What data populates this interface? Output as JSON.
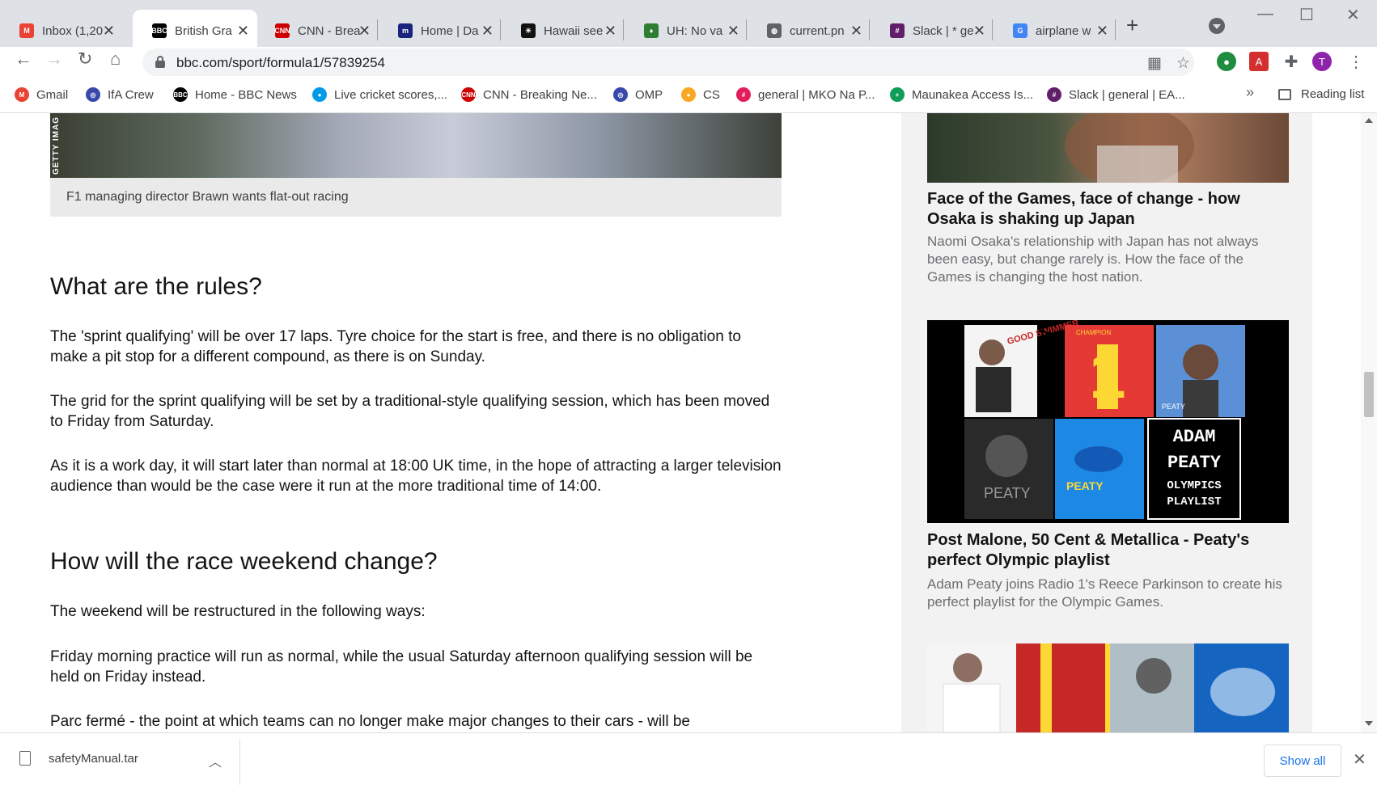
{
  "browser": {
    "tabs": [
      {
        "label": "Inbox (1,20",
        "icon": "gmail-icon",
        "color": "#ea4335",
        "glyph": "M"
      },
      {
        "label": "British Gra",
        "icon": "bbc-icon",
        "color": "#000000",
        "glyph": "BBC"
      },
      {
        "label": "CNN - Brea",
        "icon": "cnn-icon",
        "color": "#cc0000",
        "glyph": "CNN"
      },
      {
        "label": "Home | Da",
        "icon": "home-icon",
        "color": "#1a237e",
        "glyph": "m"
      },
      {
        "label": "Hawaii see",
        "icon": "hawaii-icon",
        "color": "#111111",
        "glyph": "☀"
      },
      {
        "label": "UH: No va",
        "icon": "uh-icon",
        "color": "#2e7d32",
        "glyph": "♦"
      },
      {
        "label": "current.pn",
        "icon": "globe-icon",
        "color": "#5f6368",
        "glyph": "◍"
      },
      {
        "label": "Slack | * ge",
        "icon": "slack-icon",
        "color": "#611f69",
        "glyph": "#"
      },
      {
        "label": "airplane w",
        "icon": "google-icon",
        "color": "#4285f4",
        "glyph": "G"
      }
    ],
    "url": "bbc.com/sport/formula1/57839254",
    "profile_initial": "T",
    "bookmarks": [
      {
        "label": "Gmail",
        "icon": "gmail-icon",
        "color": "#ea4335",
        "glyph": "M"
      },
      {
        "label": "IfA Crew",
        "icon": "ifa-icon",
        "color": "#3949ab",
        "glyph": "◎"
      },
      {
        "label": "Home - BBC News",
        "icon": "bbc-icon",
        "color": "#000000",
        "glyph": "BBC"
      },
      {
        "label": "Live cricket scores,...",
        "icon": "cricket-icon",
        "color": "#039be5",
        "glyph": "●"
      },
      {
        "label": "CNN - Breaking Ne...",
        "icon": "cnn-icon",
        "color": "#cc0000",
        "glyph": "CNN"
      },
      {
        "label": "OMP",
        "icon": "omp-icon",
        "color": "#3949ab",
        "glyph": "◎"
      },
      {
        "label": "CS",
        "icon": "cs-icon",
        "color": "#f9a825",
        "glyph": "●"
      },
      {
        "label": "general | MKO Na P...",
        "icon": "slack-icon",
        "color": "#e01e5a",
        "glyph": "#"
      },
      {
        "label": "Maunakea Access Is...",
        "icon": "sheets-icon",
        "color": "#0f9d58",
        "glyph": "+"
      },
      {
        "label": "Slack | general | EA...",
        "icon": "slack-icon",
        "color": "#611f69",
        "glyph": "#"
      }
    ],
    "reading_list": "Reading list"
  },
  "article": {
    "image_credit": "GETTY IMAG",
    "caption": "F1 managing director Brawn wants flat-out racing",
    "heading1": "What are the rules?",
    "para1": "The 'sprint qualifying' will be over 17 laps. Tyre choice for the start is free, and there is no obligation to make a pit stop for a different compound, as there is on Sunday.",
    "para2": "The grid for the sprint qualifying will be set by a traditional-style qualifying session, which has been moved to Friday from Saturday.",
    "para3": "As it is a work day, it will start later than normal at 18:00 UK time, in the hope of attracting a larger television audience than would be the case were it run at the more traditional time of 14:00.",
    "heading2": "How will the race weekend change?",
    "para4": "The weekend will be restructured in the following ways:",
    "para5": "Friday morning practice will run as normal, while the usual Saturday afternoon qualifying session will be held on Friday instead.",
    "para6": "Parc fermé - the point at which teams can no longer make major changes to their cars - will be"
  },
  "sidebar": {
    "story1": {
      "title": "Face of the Games, face of change - how Osaka is shaking up Japan",
      "summary": "Naomi Osaka's relationship with Japan has not always been easy, but change rarely is. How the face of the Games is changing the host nation."
    },
    "story2": {
      "image_text": {
        "good_swimmer": "GOOD SWIMMER",
        "adam_peaty_vertical": "ADAM PEATY",
        "champion": "CHAMPION",
        "number_one": "1",
        "peaty_small": "PEATY",
        "peaty_left": "PEATY",
        "peaty_center": "PEATY",
        "playlist_adam": "ADAM",
        "playlist_peaty": "PEATY",
        "playlist_olympics": "OLYMPICS",
        "playlist_word": "PLAYLIST"
      },
      "title": "Post Malone, 50 Cent & Metallica - Peaty's perfect Olympic playlist",
      "summary": "Adam Peaty joins Radio 1's Reece Parkinson to create his perfect playlist for the Olympic Games."
    }
  },
  "downloads": {
    "filename": "safetyManual.tar",
    "show_all": "Show all"
  }
}
